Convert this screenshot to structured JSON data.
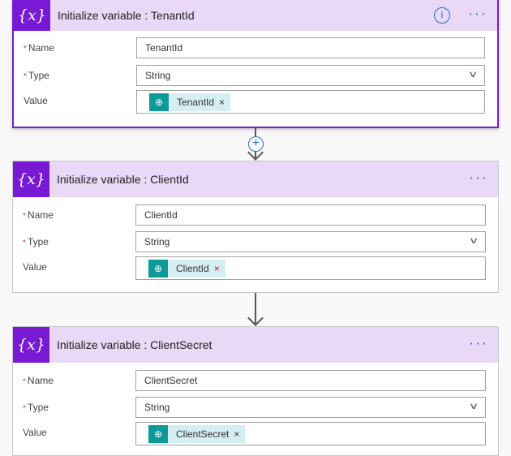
{
  "cards": [
    {
      "title": "Initialize variable : TenantId",
      "name_label": "Name",
      "type_label": "Type",
      "value_label": "Value",
      "name": "TenantId",
      "type": "String",
      "token": "TenantId"
    },
    {
      "title": "Initialize variable : ClientId",
      "name_label": "Name",
      "type_label": "Type",
      "value_label": "Value",
      "name": "ClientId",
      "type": "String",
      "token": "ClientId"
    },
    {
      "title": "Initialize variable : ClientSecret",
      "name_label": "Name",
      "type_label": "Type",
      "value_label": "Value",
      "name": "ClientSecret",
      "type": "String",
      "token": "ClientSecret"
    }
  ],
  "icons": {
    "variable": "{x}",
    "more": "···",
    "info": "i",
    "required": "*",
    "chevron": "∨",
    "remove": "×",
    "plus": "+",
    "token_icon": "⊕"
  }
}
